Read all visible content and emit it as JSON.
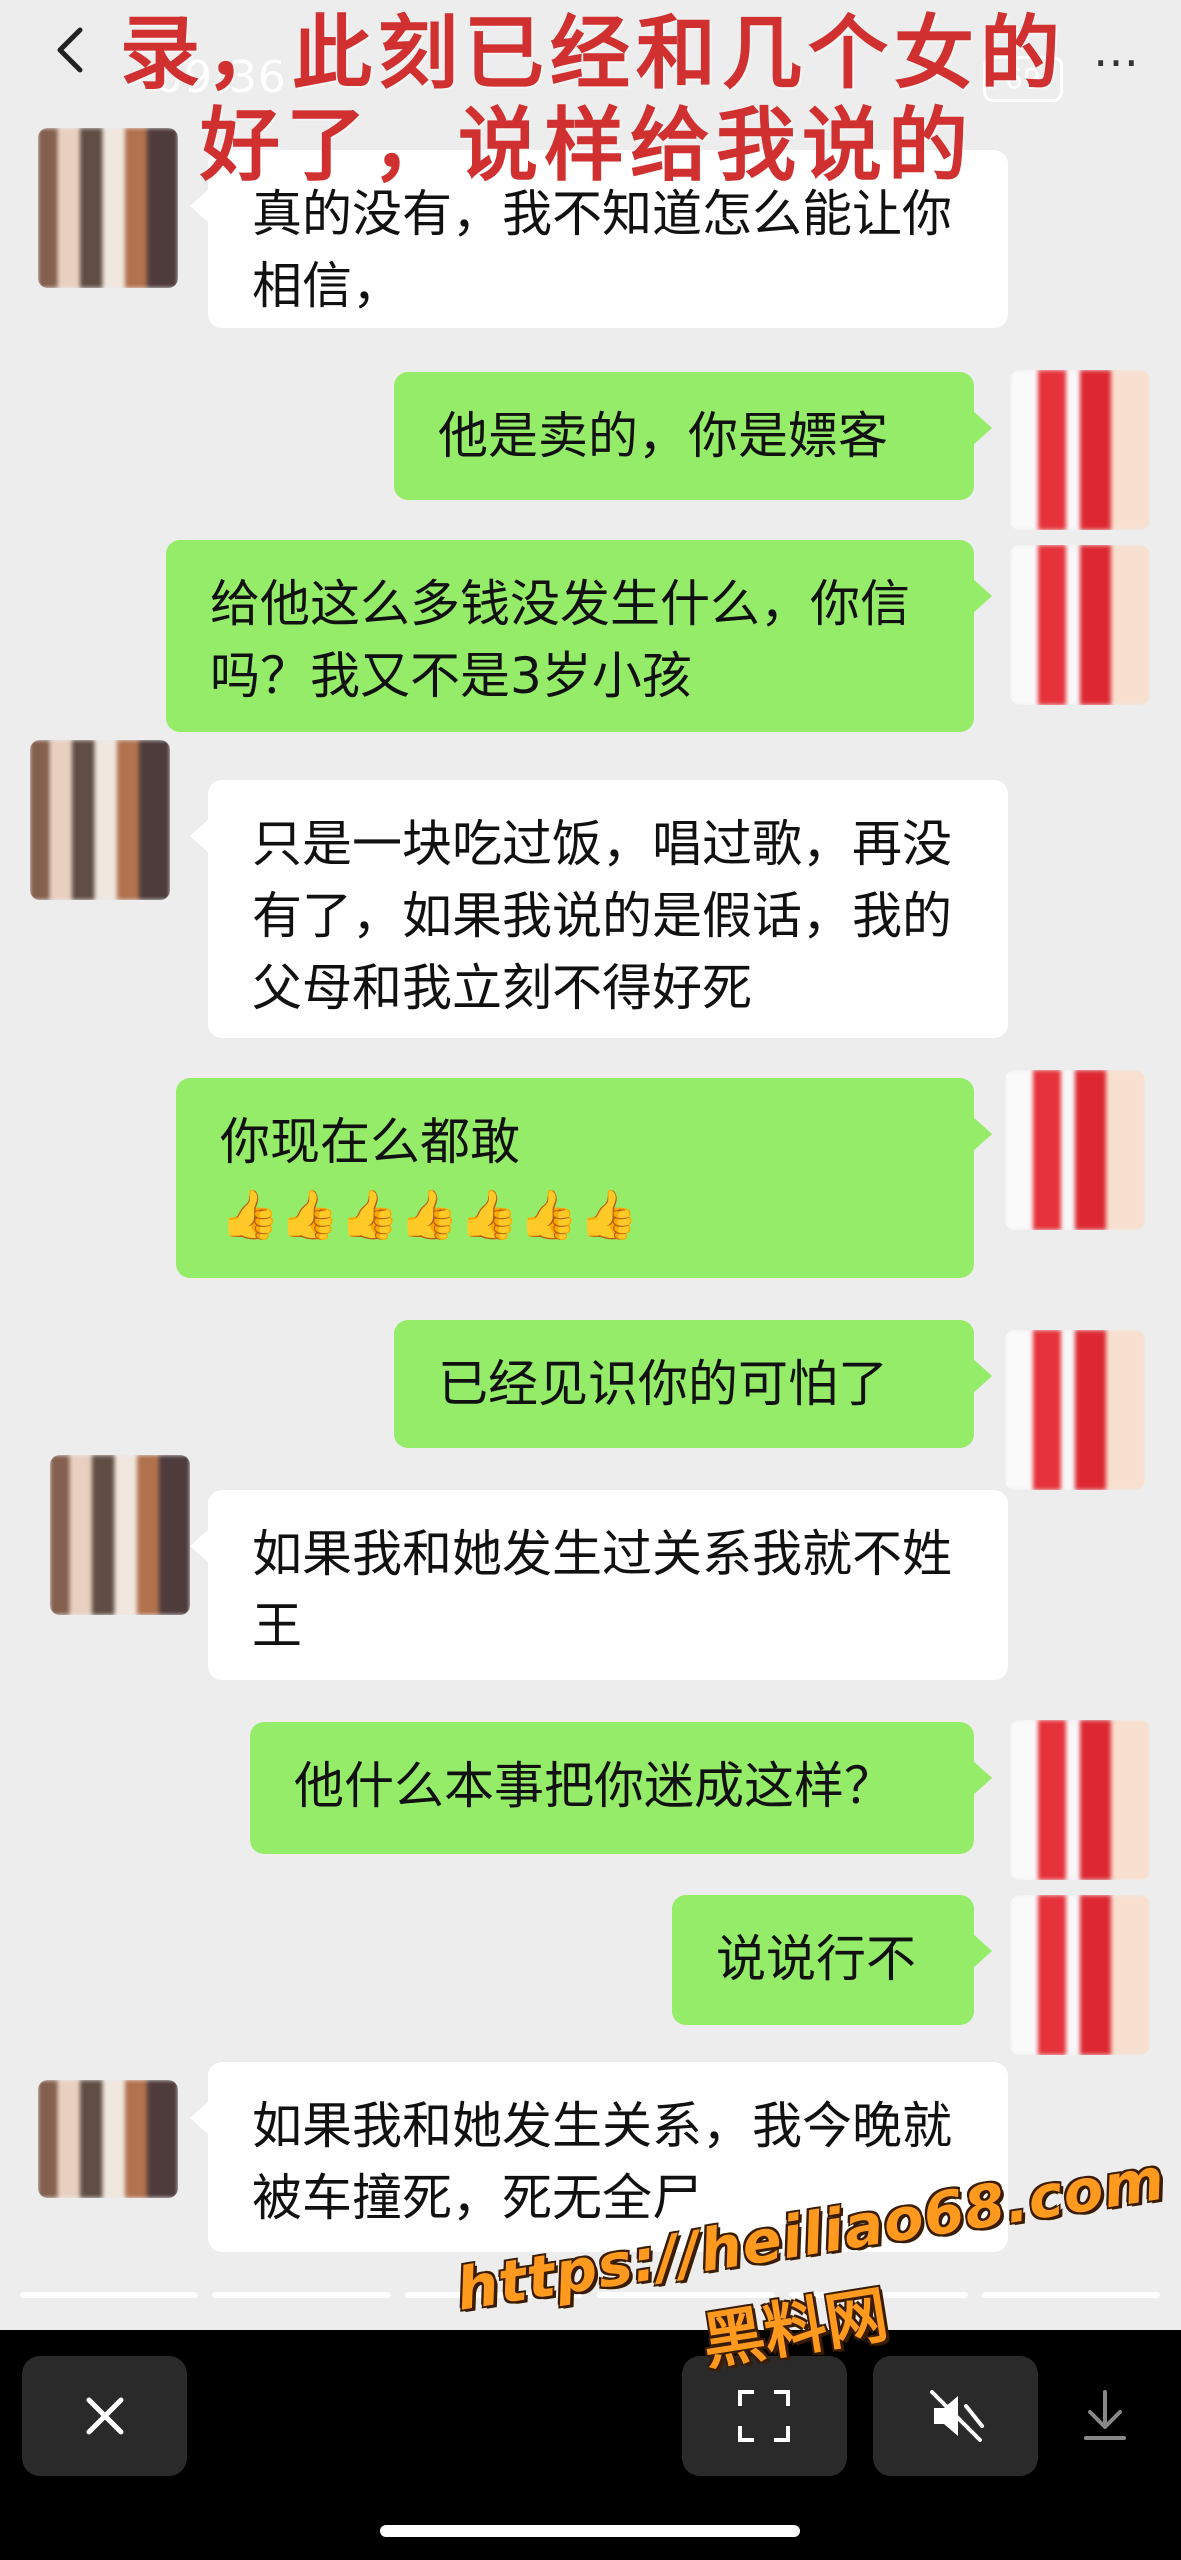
{
  "overlay": {
    "title_line1": "录，此刻已经和几个女的",
    "title_line2": "好了，说样给我说的"
  },
  "status": {
    "time": "09:36",
    "battery": "69"
  },
  "messages": [
    {
      "side": "in",
      "text": "真的没有，我不知道怎么能让你相信，"
    },
    {
      "side": "out",
      "text": "他是卖的，你是嫖客"
    },
    {
      "side": "out",
      "text": "给他这么多钱没发生什么，你信吗？我又不是3岁小孩"
    },
    {
      "side": "in",
      "text": "只是一块吃过饭，唱过歌，再没有了，如果我说的是假话，我的父母和我立刻不得好死"
    },
    {
      "side": "out",
      "text": "你现在么都敢",
      "emoji": "👍👍👍👍👍👍👍"
    },
    {
      "side": "out",
      "text": "已经见识你的可怕了"
    },
    {
      "side": "in",
      "text": "如果我和她发生过关系我就不姓王"
    },
    {
      "side": "out",
      "text": "他什么本事把你迷成这样？"
    },
    {
      "side": "out",
      "text": "说说行不"
    },
    {
      "side": "in",
      "text": "如果我和她发生关系，我今晚就被车撞死，死无全尸"
    }
  ],
  "icons": {
    "back": "chevron-left-icon",
    "more": "more-icon",
    "close": "close-icon",
    "scan": "scan-icon",
    "mute": "speaker-mute-icon",
    "download": "download-icon"
  },
  "more_label": "…",
  "watermark": {
    "url": "https://heiliao68.com",
    "site": "黑料网"
  },
  "colors": {
    "background": "#ededed",
    "incoming_bubble": "#ffffff",
    "outgoing_bubble": "#95ec69",
    "overlay_text": "#d03030",
    "watermark": "#ff9a1f"
  }
}
